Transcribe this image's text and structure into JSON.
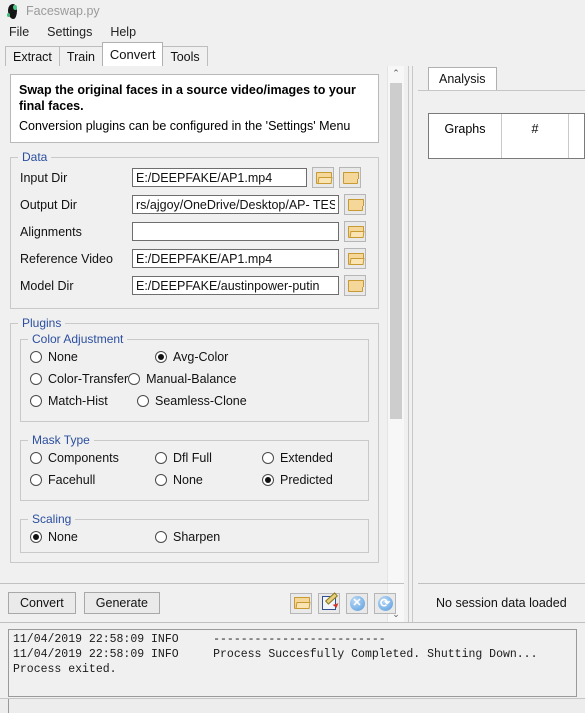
{
  "window": {
    "title": "Faceswap.py",
    "icon": "faceswap-logo-icon"
  },
  "menubar": {
    "items": [
      {
        "label": "File"
      },
      {
        "label": "Settings"
      },
      {
        "label": "Help"
      }
    ]
  },
  "tabs": {
    "items": [
      {
        "label": "Extract",
        "active": false
      },
      {
        "label": "Train",
        "active": false
      },
      {
        "label": "Convert",
        "active": true
      },
      {
        "label": "Tools",
        "active": false
      }
    ]
  },
  "info": {
    "bold_line": "Swap the original faces in a source video/images to your final faces.",
    "normal_line": "Conversion plugins can be configured in the 'Settings' Menu"
  },
  "data_group": {
    "legend": "Data",
    "rows": [
      {
        "label": "Input Dir",
        "value": "E:/DEEPFAKE/AP1.mp4",
        "placeholder": "",
        "buttons": [
          "folder-open-icon",
          "folder-closed-icon"
        ]
      },
      {
        "label": "Output Dir",
        "value": "rs/ajgoy/OneDrive/Desktop/AP- TEST",
        "placeholder": "",
        "buttons": [
          "folder-closed-icon"
        ]
      },
      {
        "label": "Alignments",
        "value": "",
        "placeholder": "",
        "buttons": [
          "folder-open-icon"
        ]
      },
      {
        "label": "Reference Video",
        "value": "E:/DEEPFAKE/AP1.mp4",
        "placeholder": "",
        "buttons": [
          "folder-open-icon"
        ]
      },
      {
        "label": "Model Dir",
        "value": "E:/DEEPFAKE/austinpower-putin",
        "placeholder": "",
        "buttons": [
          "folder-closed-icon"
        ]
      }
    ]
  },
  "plugins_group": {
    "legend": "Plugins",
    "color_adjustment": {
      "legend": "Color Adjustment",
      "options": [
        {
          "label": "None",
          "selected": false,
          "col": 1
        },
        {
          "label": "Avg-Color",
          "selected": true,
          "col": 2
        },
        {
          "label": "Color-Transfer",
          "selected": false,
          "col": 3
        },
        {
          "label": "Manual-Balance",
          "selected": false,
          "col": 1
        },
        {
          "label": "Match-Hist",
          "selected": false,
          "col": 2
        },
        {
          "label": "Seamless-Clone",
          "selected": false,
          "col": 3
        }
      ]
    },
    "mask_type": {
      "legend": "Mask Type",
      "options": [
        {
          "label": "Components",
          "selected": false,
          "col": 1
        },
        {
          "label": "Dfl Full",
          "selected": false,
          "col": 2
        },
        {
          "label": "Extended",
          "selected": false,
          "col": 3
        },
        {
          "label": "Facehull",
          "selected": false,
          "col": 1
        },
        {
          "label": "None",
          "selected": false,
          "col": 2
        },
        {
          "label": "Predicted",
          "selected": true,
          "col": 3
        }
      ]
    },
    "scaling": {
      "legend": "Scaling",
      "options": [
        {
          "label": "None",
          "selected": true,
          "col": 1
        },
        {
          "label": "Sharpen",
          "selected": false,
          "col": 2
        }
      ]
    }
  },
  "scrollbar": {
    "up_arrow": "⌃",
    "down_arrow": "⌄"
  },
  "actionbar": {
    "convert_label": "Convert",
    "generate_label": "Generate",
    "tools": [
      {
        "name": "load-config-icon"
      },
      {
        "name": "save-config-icon"
      },
      {
        "name": "clear-config-icon"
      },
      {
        "name": "reset-config-icon"
      }
    ]
  },
  "analysis": {
    "tab_label": "Analysis",
    "table": {
      "columns": [
        "Graphs",
        "#",
        ""
      ],
      "rows": []
    },
    "status": "No session data loaded"
  },
  "console": {
    "lines": [
      "11/04/2019 22:58:09 INFO     -------------------------",
      "11/04/2019 22:58:09 INFO     Process Succesfully Completed. Shutting Down...",
      "Process exited."
    ]
  },
  "colors": {
    "legend_blue": "#2b4f9e",
    "window_bg": "#f0f0f0",
    "field_bg": "#ffffff",
    "folder_yellow": "#f6d79a",
    "icon_blue": "#7fb5e8"
  }
}
